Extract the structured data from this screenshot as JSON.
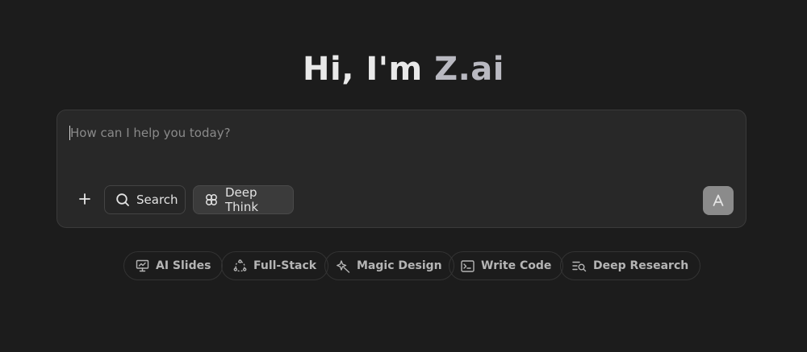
{
  "greeting": {
    "prefix": "Hi, I'm ",
    "brand": "Z.ai"
  },
  "composer": {
    "placeholder": "How can I help you today?",
    "value": "",
    "add_icon": "plus-icon",
    "tools": [
      {
        "label": "Search",
        "icon": "search-icon",
        "active": false
      },
      {
        "label": "Deep Think",
        "icon": "deep-think-icon",
        "active": true
      }
    ],
    "send_icon": "send-arrow-icon"
  },
  "suggestions": [
    {
      "label": "AI Slides",
      "icon": "presentation-icon"
    },
    {
      "label": "Full-Stack",
      "icon": "cycle-icon"
    },
    {
      "label": "Magic Design",
      "icon": "magic-design-icon"
    },
    {
      "label": "Write Code",
      "icon": "terminal-icon"
    },
    {
      "label": "Deep Research",
      "icon": "research-icon"
    }
  ],
  "colors": {
    "background": "#1c1c1c",
    "composer": "#282828",
    "active_tool": "#3b3b3b",
    "send_button": "#8b8b8b",
    "brand_text": "#b9b9c1"
  }
}
